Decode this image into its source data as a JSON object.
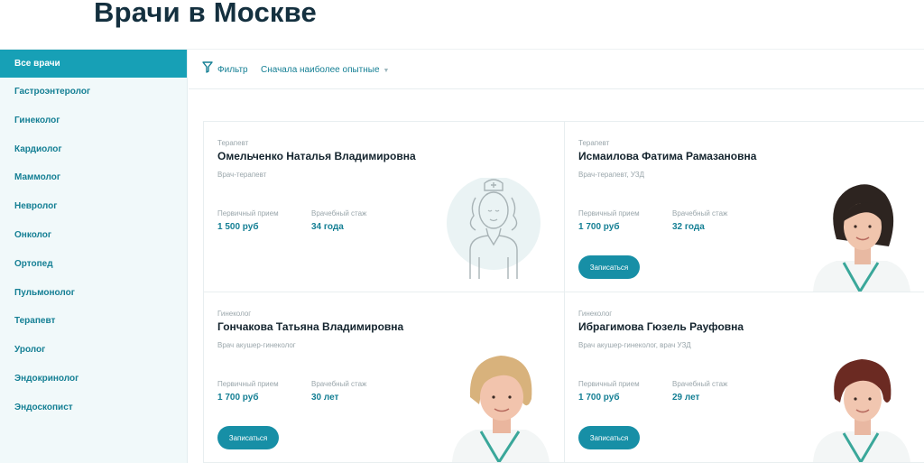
{
  "page": {
    "title": "Врачи в Москве"
  },
  "sidebar": {
    "items": [
      {
        "label": "Все врачи",
        "active": true
      },
      {
        "label": "Гастроэнтеролог"
      },
      {
        "label": "Гинеколог"
      },
      {
        "label": "Кардиолог"
      },
      {
        "label": "Маммолог"
      },
      {
        "label": "Невролог"
      },
      {
        "label": "Онколог"
      },
      {
        "label": "Ортопед"
      },
      {
        "label": "Пульмонолог"
      },
      {
        "label": "Терапевт"
      },
      {
        "label": "Уролог"
      },
      {
        "label": "Эндокринолог"
      },
      {
        "label": "Эндоскопист"
      }
    ]
  },
  "toolbar": {
    "filter_label": "Фильтр",
    "sort_label": "Сначала наиболее опытные"
  },
  "labels": {
    "price": "Первичный прием",
    "experience": "Врачебный стаж",
    "book": "Записаться"
  },
  "doctors": [
    {
      "specialty": "Терапевт",
      "name": "Омельченко Наталья Владимировна",
      "position": "Врач-терапевт",
      "price": "1 500 руб",
      "experience": "34 года",
      "photo": "placeholder-avatar-icon"
    },
    {
      "specialty": "Терапевт",
      "name": "Исмаилова Фатима Рамазановна",
      "position": "Врач-терапевт, УЗД",
      "price": "1 700 руб",
      "experience": "32 года",
      "photo": "doctor-photo"
    },
    {
      "specialty": "Гинеколог",
      "name": "Гончакова Татьяна Владимировна",
      "position": "Врач акушер-гинеколог",
      "price": "1 700 руб",
      "experience": "30 лет",
      "photo": "doctor-photo"
    },
    {
      "specialty": "Гинеколог",
      "name": "Ибрагимова Гюзель Рауфовна",
      "position": "Врач акушер-гинеколог, врач УЗД",
      "price": "1 700 руб",
      "experience": "29 лет",
      "photo": "doctor-photo"
    }
  ],
  "colors": {
    "accent": "#17a0b6",
    "accent_text": "#147f94",
    "button": "#178fa6",
    "sidebar_bg": "#f1f9fa"
  }
}
